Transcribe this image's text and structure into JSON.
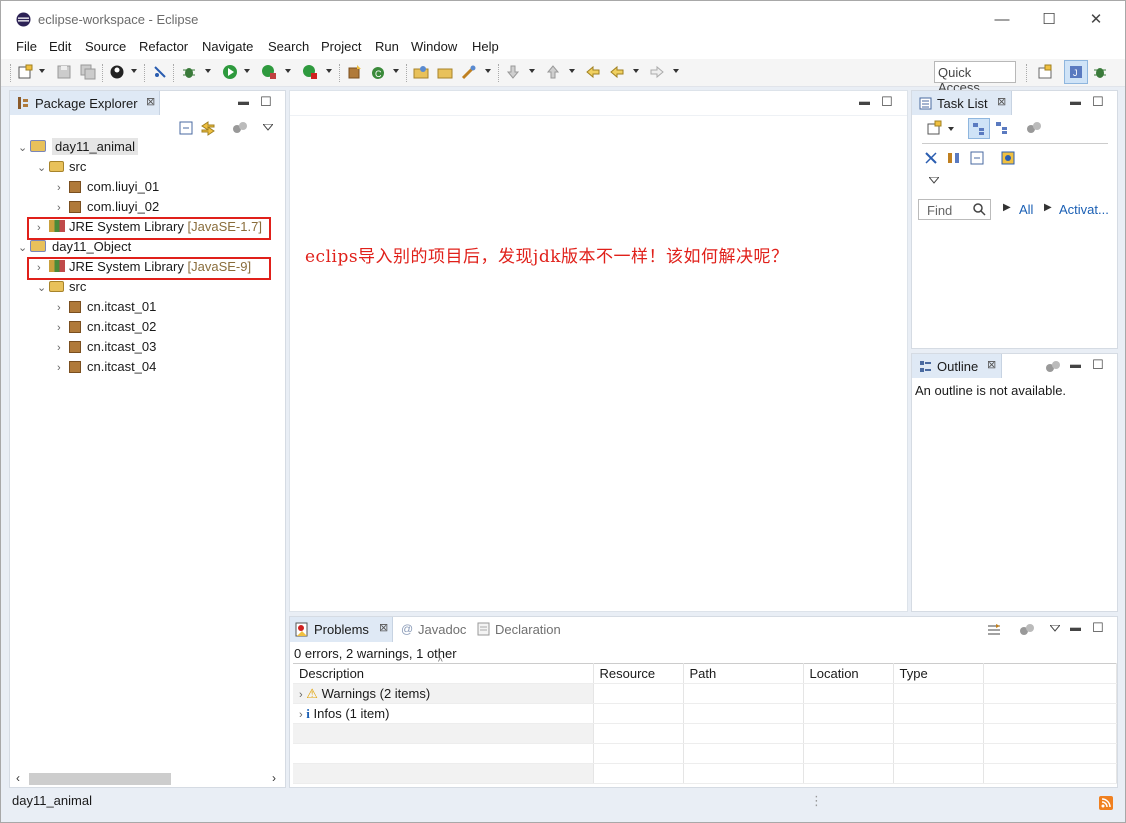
{
  "window": {
    "title": "eclipse-workspace - Eclipse",
    "minimize": "—",
    "maximize": "☐",
    "close": "✕"
  },
  "menu": [
    "File",
    "Edit",
    "Source",
    "Refactor",
    "Navigate",
    "Search",
    "Project",
    "Run",
    "Window",
    "Help"
  ],
  "toolbar": {
    "quick_access": "Quick Access"
  },
  "package_explorer": {
    "tab_label": "Package Explorer",
    "tree": [
      {
        "label": "day11_animal",
        "type": "project",
        "expanded": true
      },
      {
        "label": "src",
        "type": "folder",
        "expanded": true
      },
      {
        "label": "com.liuyi_01",
        "type": "package"
      },
      {
        "label": "com.liuyi_02",
        "type": "package"
      },
      {
        "label": "JRE System Library",
        "version": "[JavaSE-1.7]",
        "type": "library"
      },
      {
        "label": "day11_Object",
        "type": "project",
        "expanded": true
      },
      {
        "label": "JRE System Library",
        "version": "[JavaSE-9]",
        "type": "library"
      },
      {
        "label": "src",
        "type": "folder",
        "expanded": true
      },
      {
        "label": "cn.itcast_01",
        "type": "package"
      },
      {
        "label": "cn.itcast_02",
        "type": "package"
      },
      {
        "label": "cn.itcast_03",
        "type": "package"
      },
      {
        "label": "cn.itcast_04",
        "type": "package"
      }
    ]
  },
  "editor": {
    "annotation": "eclips导入别的项目后，发现jdk版本不一样！该如何解决呢？"
  },
  "task_list": {
    "tab_label": "Task List",
    "find_placeholder": "Find",
    "all_label": "All",
    "activate_label": "Activat..."
  },
  "outline": {
    "tab_label": "Outline",
    "message": "An outline is not available."
  },
  "problems": {
    "tabs": [
      "Problems",
      "Javadoc",
      "Declaration"
    ],
    "summary": "0 errors, 2 warnings, 1 other",
    "columns": [
      "Description",
      "Resource",
      "Path",
      "Location",
      "Type"
    ],
    "rows": [
      {
        "label": "Warnings (2 items)",
        "icon": "warning-icon"
      },
      {
        "label": "Infos (1 item)",
        "icon": "info-icon"
      }
    ]
  },
  "status": {
    "selected": "day11_animal"
  },
  "colors": {
    "highlight_red": "#e0201a",
    "accent_blue": "#1a5fb4"
  }
}
